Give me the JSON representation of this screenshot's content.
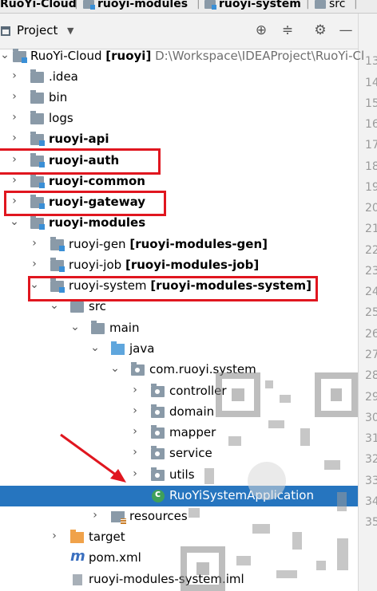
{
  "breadcrumb": [
    {
      "label": "RuoYi-Cloud",
      "style": "bold"
    },
    {
      "label": "ruoyi-modules",
      "style": "bold"
    },
    {
      "label": "ruoyi-system",
      "style": "bold"
    },
    {
      "label": "src",
      "style": "plain"
    }
  ],
  "panel": {
    "title": "Project",
    "icons": [
      "target-icon",
      "collapse-icon",
      "gear-icon",
      "minimize-icon"
    ]
  },
  "tree": {
    "root": {
      "name": "RuoYi-Cloud",
      "module": "[ruoyi]",
      "path": "D:\\Workspace\\IDEAProject\\RuoYi-Cl"
    },
    "items": [
      {
        "label": ".idea"
      },
      {
        "label": "bin"
      },
      {
        "label": "logs"
      },
      {
        "label": "ruoyi-api"
      },
      {
        "label": "ruoyi-auth"
      },
      {
        "label": "ruoyi-common"
      },
      {
        "label": "ruoyi-gateway"
      },
      {
        "label": "ruoyi-modules"
      },
      {
        "label": "ruoyi-gen",
        "module": "[ruoyi-modules-gen]"
      },
      {
        "label": "ruoyi-job",
        "module": "[ruoyi-modules-job]"
      },
      {
        "label": "ruoyi-system",
        "module": "[ruoyi-modules-system]"
      },
      {
        "label": "src"
      },
      {
        "label": "main"
      },
      {
        "label": "java"
      },
      {
        "label": "com.ruoyi.system"
      },
      {
        "label": "controller"
      },
      {
        "label": "domain"
      },
      {
        "label": "mapper"
      },
      {
        "label": "service"
      },
      {
        "label": "utils"
      },
      {
        "label": "RuoYiSystemApplication"
      },
      {
        "label": "resources"
      },
      {
        "label": "target"
      },
      {
        "label": "pom.xml"
      },
      {
        "label": "ruoyi-modules-system.iml"
      }
    ]
  },
  "gutter_lines": [
    "13",
    "14",
    "15",
    "16",
    "17",
    "18",
    "19",
    "20",
    "21",
    "22",
    "23",
    "24",
    "25",
    "26",
    "27",
    "28",
    "29",
    "30",
    "31",
    "32",
    "33",
    "34",
    "35"
  ],
  "colors": {
    "selection": "#2675bf",
    "highlight": "#e0161f"
  }
}
